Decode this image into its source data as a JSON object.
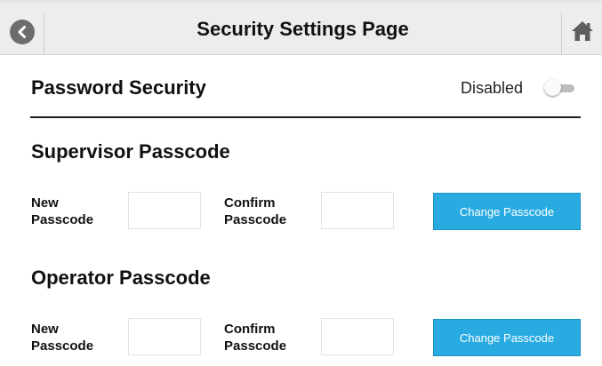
{
  "header": {
    "title": "Security Settings Page",
    "back_icon": "chevron-left-icon",
    "home_icon": "home-icon"
  },
  "password_security": {
    "title": "Password Security",
    "status": "Disabled",
    "enabled": false
  },
  "supervisor": {
    "title": "Supervisor Passcode",
    "new_label_line1": "New",
    "new_label_line2": "Passcode",
    "confirm_label_line1": "Confirm",
    "confirm_label_line2": "Passcode",
    "new_value": "",
    "confirm_value": "",
    "button_label": "Change Passcode"
  },
  "operator": {
    "title": "Operator Passcode",
    "new_label_line1": "New",
    "new_label_line2": "Passcode",
    "confirm_label_line1": "Confirm",
    "confirm_label_line2": "Passcode",
    "new_value": "",
    "confirm_value": "",
    "button_label": "Change Passcode"
  },
  "colors": {
    "accent": "#29abe2",
    "header_bg": "#ededed"
  }
}
